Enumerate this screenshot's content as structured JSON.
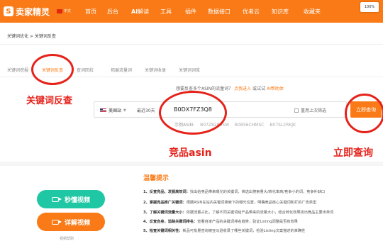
{
  "app": {
    "logo_text": "卖家精灵",
    "logo_mark": "S",
    "lang": "中文"
  },
  "nav": [
    {
      "label": "首页"
    },
    {
      "label": "后台"
    },
    {
      "label_ai": "AI",
      "label": "解读"
    },
    {
      "label": "工具"
    },
    {
      "label": "插件"
    },
    {
      "label": "数据接口"
    },
    {
      "label": "优者云"
    },
    {
      "label": "知识库"
    },
    {
      "label": "收藏夹"
    }
  ],
  "window_badge": "100%",
  "breadcrumb": "关键词优化 > 关键词反查",
  "tabs": [
    {
      "label": "关键词挖掘"
    },
    {
      "label": "关键词反查",
      "active": true
    },
    {
      "label": "查词回拉"
    },
    {
      "label": "拓展流量词"
    },
    {
      "label": "关键词收录"
    },
    {
      "label": "关键词词库"
    }
  ],
  "callouts": {
    "left": "关键词反查",
    "mid": "竞品asin",
    "right": "立即查询"
  },
  "hint": {
    "text": "想要反查多个ASIN的流量词？",
    "link": "点我进入",
    "or": "或试试",
    "ai": "AI帮助体"
  },
  "search": {
    "site": "美国站",
    "range": "最近30天",
    "asin": "B0DX7FZ3Q8",
    "reuse": "重用上次筛选",
    "button": "立即查询"
  },
  "example": {
    "label": "示例ASIN:",
    "items": [
      "B07Z8289SW",
      "B0B56CHMSC",
      "B07SL2RKJK"
    ]
  },
  "videos": {
    "primary": "秒懂视频",
    "secondary": "详解视频",
    "caption": "视频帮助"
  },
  "tips": {
    "title": "温馨提示",
    "items": [
      {
        "head": "1、反查竞品、发掘高效词：",
        "body": "找出给竞品带来曝光的关键词，筛选出搜索量大/转化率高/竞争小的词，竞争补缺口"
      },
      {
        "head": "2、掌握竞品推广关键词：",
        "body": "根据ASIN在站内关键词搜索下的曝光位置，明确竞品核心关键词和打的广告类型"
      },
      {
        "head": "3、了解关键词流量大小：",
        "body": "依据流量占比，了解不同关键词给产品带来的流量大小，结合转化效果找出竞品主要出单词"
      },
      {
        "head": "4、反查自身，追踪关键词排名：",
        "body": "查看自家产品的关键词排名趋势，验证Listing调整是否有效果"
      },
      {
        "head": "5、检查关键词相关性：",
        "body": "新品可批量查询被亚马逊收录了哪些关键词，检验Listing文案描述的准确性"
      }
    ]
  },
  "colors": {
    "brand": "#f97a16",
    "annotation": "#e5231b",
    "video_green": "#1fc7a4"
  }
}
